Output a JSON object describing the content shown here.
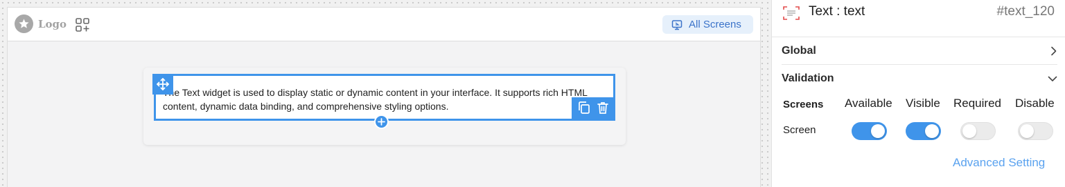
{
  "canvas": {
    "logo_text": "Logo",
    "all_screens_label": "All Screens",
    "widget_text": "The Text widget is used to display static or dynamic content in your interface. It supports rich HTML content, dynamic data binding, and comprehensive styling options."
  },
  "panel": {
    "title": "Text : text",
    "widget_id": "#text_120",
    "sections": {
      "global_label": "Global",
      "validation_label": "Validation"
    },
    "validation": {
      "columns": [
        "Screens",
        "Available",
        "Visible",
        "Required",
        "Disable"
      ],
      "row_label": "Screen",
      "toggles": {
        "available": true,
        "visible": true,
        "required": false,
        "disable": false
      }
    },
    "advanced_label": "Advanced Setting"
  },
  "colors": {
    "accent": "#3f94ea",
    "link": "#5aa2ef",
    "chip_bg": "#e6f0fb"
  },
  "icons": [
    "star-icon",
    "apps-add-icon",
    "monitor-icon",
    "move-icon",
    "copy-icon",
    "trash-icon",
    "plus-icon",
    "text-widget-icon",
    "chevron-right-icon",
    "chevron-down-icon"
  ]
}
